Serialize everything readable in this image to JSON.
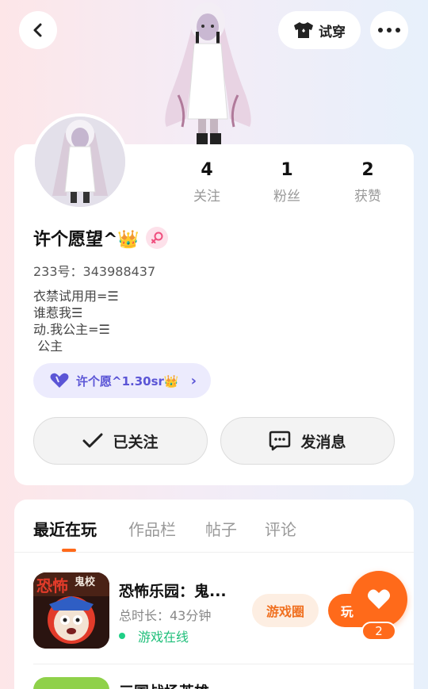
{
  "header": {
    "tryon_label": "试穿",
    "icons": {
      "back": "chevron-left-icon",
      "tryon": "shirt-icon",
      "more": "more-dots-icon"
    }
  },
  "profile": {
    "stats": [
      {
        "value": "4",
        "label": "关注"
      },
      {
        "value": "1",
        "label": "粉丝"
      },
      {
        "value": "2",
        "label": "获赞"
      }
    ],
    "username": "许个愿望^👑",
    "gender_icon": "female-icon",
    "user_id": "233号：343988437",
    "bio_lines": [
      "衣禁试用用=☰",
      "谁惹我☰",
      "动.我公主=☰",
      " 公主"
    ],
    "tag": {
      "label": "许个愿^1.30sr👑",
      "icon": "heart-icon"
    },
    "follow_label": "已关注",
    "message_label": "发消息"
  },
  "tabs": [
    "最近在玩",
    "作品栏",
    "帖子",
    "评论"
  ],
  "active_tab": "最近在玩",
  "recent_game": {
    "title": "恐怖乐园：鬼...",
    "icon_text": "恐怖",
    "icon_text2": "鬼校",
    "duration": "总时长：43分钟",
    "status": "游戏在线",
    "circle_label": "游戏圈",
    "play_label": "玩"
  },
  "next_game": {
    "title": "三国战场英雄"
  },
  "like": {
    "count": "2",
    "icon": "heart-icon"
  },
  "colors": {
    "accent": "#ff6a1a",
    "online": "#1fcf86",
    "tag_text": "#5b55d6"
  }
}
